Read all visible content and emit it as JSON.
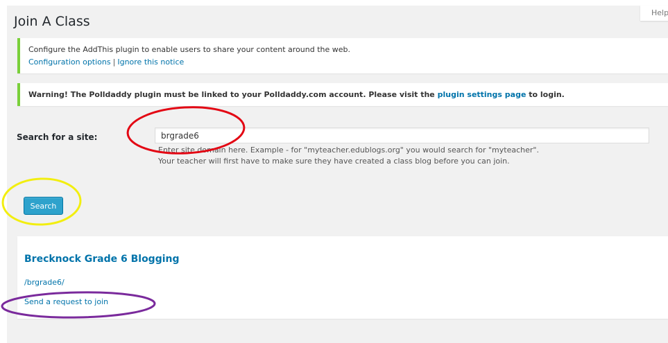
{
  "page": {
    "title": "Join A Class",
    "help_label": "Help"
  },
  "notices": {
    "addthis": {
      "message": "Configure the AddThis plugin to enable users to share your content around the web.",
      "config_link": "Configuration options",
      "separator": "|",
      "ignore_link": "Ignore this notice"
    },
    "polldaddy": {
      "text_before": "Warning! The Polldaddy plugin must be linked to your Polldaddy.com account. Please visit the ",
      "link": "plugin settings page",
      "text_after": " to login."
    }
  },
  "search": {
    "label": "Search for a site:",
    "value": "brgrade6",
    "hint_line1": "Enter site domain here. Example - for \"myteacher.edublogs.org\" you would search for \"myteacher\".",
    "hint_line2": "Your teacher will first have to make sure they have created a class blog before you can join.",
    "button_label": "Search"
  },
  "result": {
    "title": "Brecknock Grade 6 Blogging",
    "path": "/brgrade6/",
    "request_link": "Send a request to join"
  },
  "colors": {
    "notice_border": "#7ad03a",
    "link": "#0073aa",
    "button": "#2ea2cc",
    "annotation_red": "#e30613",
    "annotation_yellow": "#f2ee10",
    "annotation_purple": "#7a2a9c"
  }
}
